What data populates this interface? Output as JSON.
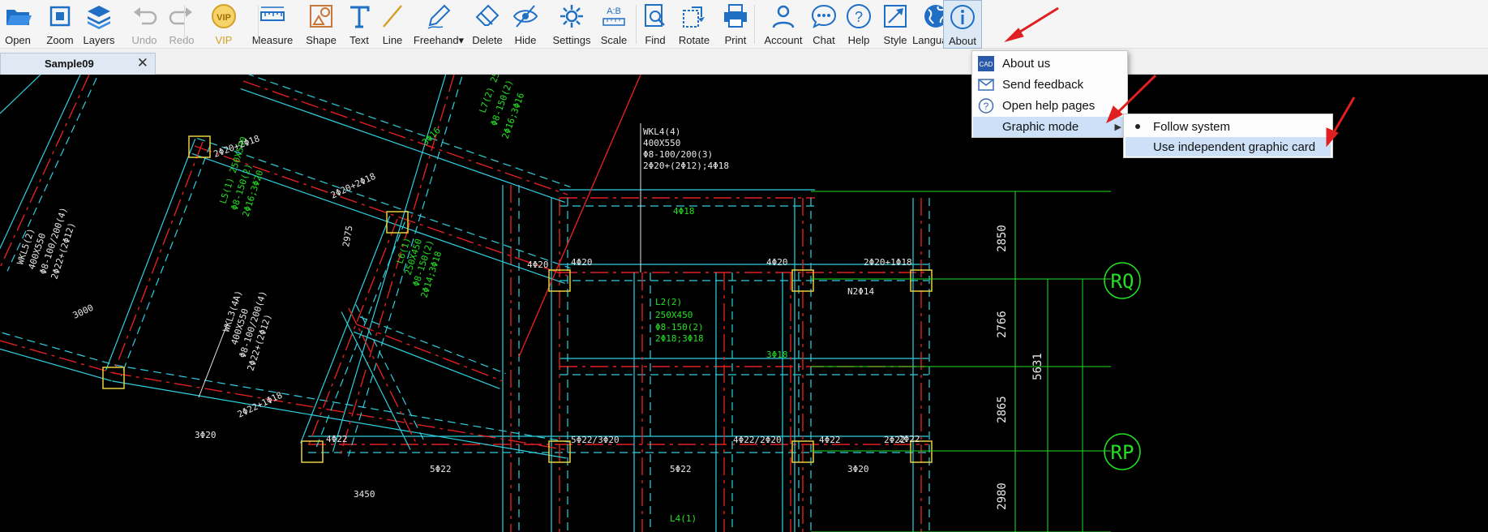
{
  "toolbar": {
    "items": [
      {
        "label": "Open",
        "icon": "folder-open-icon"
      },
      {
        "label": "Zoom",
        "icon": "zoom-icon"
      },
      {
        "label": "Layers",
        "icon": "layers-icon"
      },
      {
        "label": "Undo",
        "icon": "undo-icon",
        "disabled": true
      },
      {
        "label": "Redo",
        "icon": "redo-icon",
        "disabled": true
      },
      {
        "label": "VIP",
        "icon": "vip-icon"
      },
      {
        "label": "Measure",
        "icon": "ruler-icon"
      },
      {
        "label": "Shape",
        "icon": "shape-icon"
      },
      {
        "label": "Text",
        "icon": "text-icon"
      },
      {
        "label": "Line",
        "icon": "line-icon"
      },
      {
        "label": "Freehand",
        "icon": "pen-icon"
      },
      {
        "label": "Delete",
        "icon": "eraser-icon"
      },
      {
        "label": "Hide",
        "icon": "eye-slash-icon"
      },
      {
        "label": "Settings",
        "icon": "settings-icon"
      },
      {
        "label": "Scale",
        "icon": "scale-icon"
      },
      {
        "label": "Find",
        "icon": "find-icon"
      },
      {
        "label": "Rotate",
        "icon": "rotate-icon"
      },
      {
        "label": "Print",
        "icon": "printer-icon"
      },
      {
        "label": "Account",
        "icon": "user-icon"
      },
      {
        "label": "Chat",
        "icon": "chat-icon"
      },
      {
        "label": "Help",
        "icon": "help-icon"
      },
      {
        "label": "Style",
        "icon": "style-icon"
      },
      {
        "label": "Language",
        "icon": "globe-icon"
      },
      {
        "label": "About",
        "icon": "info-icon",
        "active": true
      }
    ]
  },
  "tab": {
    "title": "Sample09",
    "close": "✕"
  },
  "menu": {
    "items": [
      {
        "label": "About us",
        "icon": "cad-logo-icon"
      },
      {
        "label": "Send feedback",
        "icon": "mail-icon"
      },
      {
        "label": "Open help pages",
        "icon": "question-icon"
      },
      {
        "label": "Graphic mode",
        "has_submenu": true,
        "highlighted": true
      }
    ],
    "submenu": [
      {
        "label": "Follow system",
        "selected": true
      },
      {
        "label": "Use independent graphic card",
        "highlighted": true
      }
    ]
  },
  "drawing": {
    "labels": [
      {
        "t": "WKL4(4)"
      },
      {
        "t": "400X550"
      },
      {
        "t": "Φ8-100/200(3)"
      },
      {
        "t": "2Φ20+(2Φ12);4Φ18"
      },
      {
        "t": "L7(2) 250X550"
      },
      {
        "t": "Φ8-150(2)"
      },
      {
        "t": "2Φ16;3Φ16"
      },
      {
        "t": "L5(1) 250X500"
      },
      {
        "t": "Φ8-150(2)"
      },
      {
        "t": "2Φ16;3Φ20"
      },
      {
        "t": "L6(1)"
      },
      {
        "t": "250X450"
      },
      {
        "t": "Φ8-150(2)"
      },
      {
        "t": "2Φ14;3Φ18"
      },
      {
        "t": "L2(2)"
      },
      {
        "t": "250X450"
      },
      {
        "t": "Φ8-150(2)"
      },
      {
        "t": "2Φ18;3Φ18"
      },
      {
        "t": "WKL3(4A)"
      },
      {
        "t": "400X550"
      },
      {
        "t": "Φ8-100/200(4)"
      },
      {
        "t": "2Φ22+(2Φ12)"
      },
      {
        "t": "WKL5(2)"
      },
      {
        "t": "400X550"
      },
      {
        "t": "Φ8-100/200(4)"
      },
      {
        "t": "2Φ22+(2Φ12)"
      },
      {
        "t": "4Φ18"
      },
      {
        "t": "2Φ20+1Φ18"
      },
      {
        "t": "4Φ20"
      },
      {
        "t": "4Φ20"
      },
      {
        "t": "N2Φ14"
      },
      {
        "t": "3Φ18"
      },
      {
        "t": "5Φ22/3Φ20"
      },
      {
        "t": "4Φ22/2Φ20"
      },
      {
        "t": "4Φ22"
      },
      {
        "t": "2Φ22"
      },
      {
        "t": "5Φ22"
      },
      {
        "t": "5Φ22"
      },
      {
        "t": "3Φ20"
      },
      {
        "t": "3Φ20"
      },
      {
        "t": "2Φ22+1Φ18"
      },
      {
        "t": "2Φ20+2Φ18"
      },
      {
        "t": "2Φ20+2Φ18"
      },
      {
        "t": "3450"
      },
      {
        "t": "3000"
      },
      {
        "t": "2975"
      },
      {
        "t": "L4(1)"
      },
      {
        "t": "4Φ22"
      },
      {
        "t": "2Φ22"
      },
      {
        "t": "3Φ16"
      },
      {
        "t": "4Φ20"
      }
    ],
    "dims": [
      {
        "t": "2850"
      },
      {
        "t": "2766"
      },
      {
        "t": "2865"
      },
      {
        "t": "2980"
      },
      {
        "t": "5631"
      }
    ],
    "axes": [
      {
        "t": "RQ"
      },
      {
        "t": "RP"
      }
    ]
  }
}
